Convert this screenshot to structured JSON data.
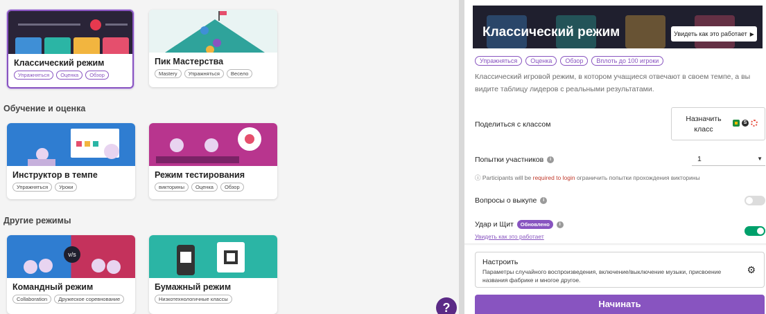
{
  "modes": {
    "top": [
      {
        "title": "Классический режим",
        "tags": [
          "Упражняться",
          "Оценка",
          "Обзор"
        ],
        "selected": true
      },
      {
        "title": "Пик Мастерства",
        "tags": [
          "Mastery",
          "Упражняться",
          "Весело"
        ]
      }
    ],
    "learning_heading": "Обучение и оценка",
    "learning": [
      {
        "title": "Инструктор в темпе",
        "tags": [
          "Упражняться",
          "Уроки"
        ]
      },
      {
        "title": "Режим тестирования",
        "tags": [
          "викторины",
          "Оценка",
          "Обзор"
        ]
      }
    ],
    "other_heading": "Другие режимы",
    "other": [
      {
        "title": "Командный режим",
        "tags": [
          "Collaboration",
          "Дружеское соревнование"
        ],
        "thumb_text": "v/s"
      },
      {
        "title": "Бумажный режим",
        "tags": [
          "Низкотехнологичные классы"
        ]
      }
    ]
  },
  "detail": {
    "title": "Классический режим",
    "watch_label": "Увидеть как это работает",
    "tags": [
      "Упражняться",
      "Оценка",
      "Обзор",
      "Вплоть до 100 игроки"
    ],
    "description": "Классический игровой режим, в котором учащиеся отвечают в своем темпе, а вы видите таблицу лидеров с реальными результатами.",
    "share_label": "Поделиться с классом",
    "assign_label": "Назначить класс",
    "attempts_label": "Попытки участников",
    "attempts_value": "1",
    "note_prefix": "ⓘ Participants will be ",
    "note_link": "required to login",
    "note_suffix": " ограничить попытки прохождения викторины",
    "redemption_label": "Вопросы о выкупе",
    "redemption_on": false,
    "strike_label": "Удар и Щит",
    "strike_badge": "Обновлено",
    "strike_on": true,
    "strike_link": "Увидеть как это работает",
    "customize_title": "Настроить",
    "customize_desc": "Параметры случайного воспроизведения, включение/выключение музыки, присвоение названия фабрике и многое другое.",
    "start_label": "Начинать"
  },
  "help_label": "?",
  "colors": {
    "accent": "#8854c0",
    "toggle_on": "#00a06b",
    "hero_bg": "#1f1f2e"
  },
  "icons": [
    "google-classroom-icon",
    "schoology-icon",
    "canvas-icon",
    "info-icon",
    "gear-icon",
    "play-icon",
    "chevron-down-icon",
    "help-icon"
  ]
}
